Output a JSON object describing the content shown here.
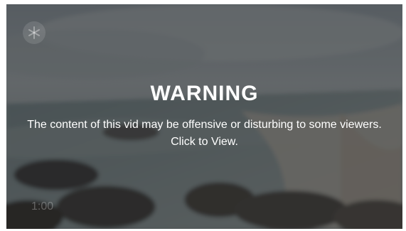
{
  "warning": {
    "title": "WARNING",
    "message": "The content of this vid may be offensive or disturbing to some viewers. Click to View."
  },
  "player": {
    "duration": "1:00",
    "badge_icon": "asterisk-icon",
    "overlay_color": "#2a2c2e"
  }
}
